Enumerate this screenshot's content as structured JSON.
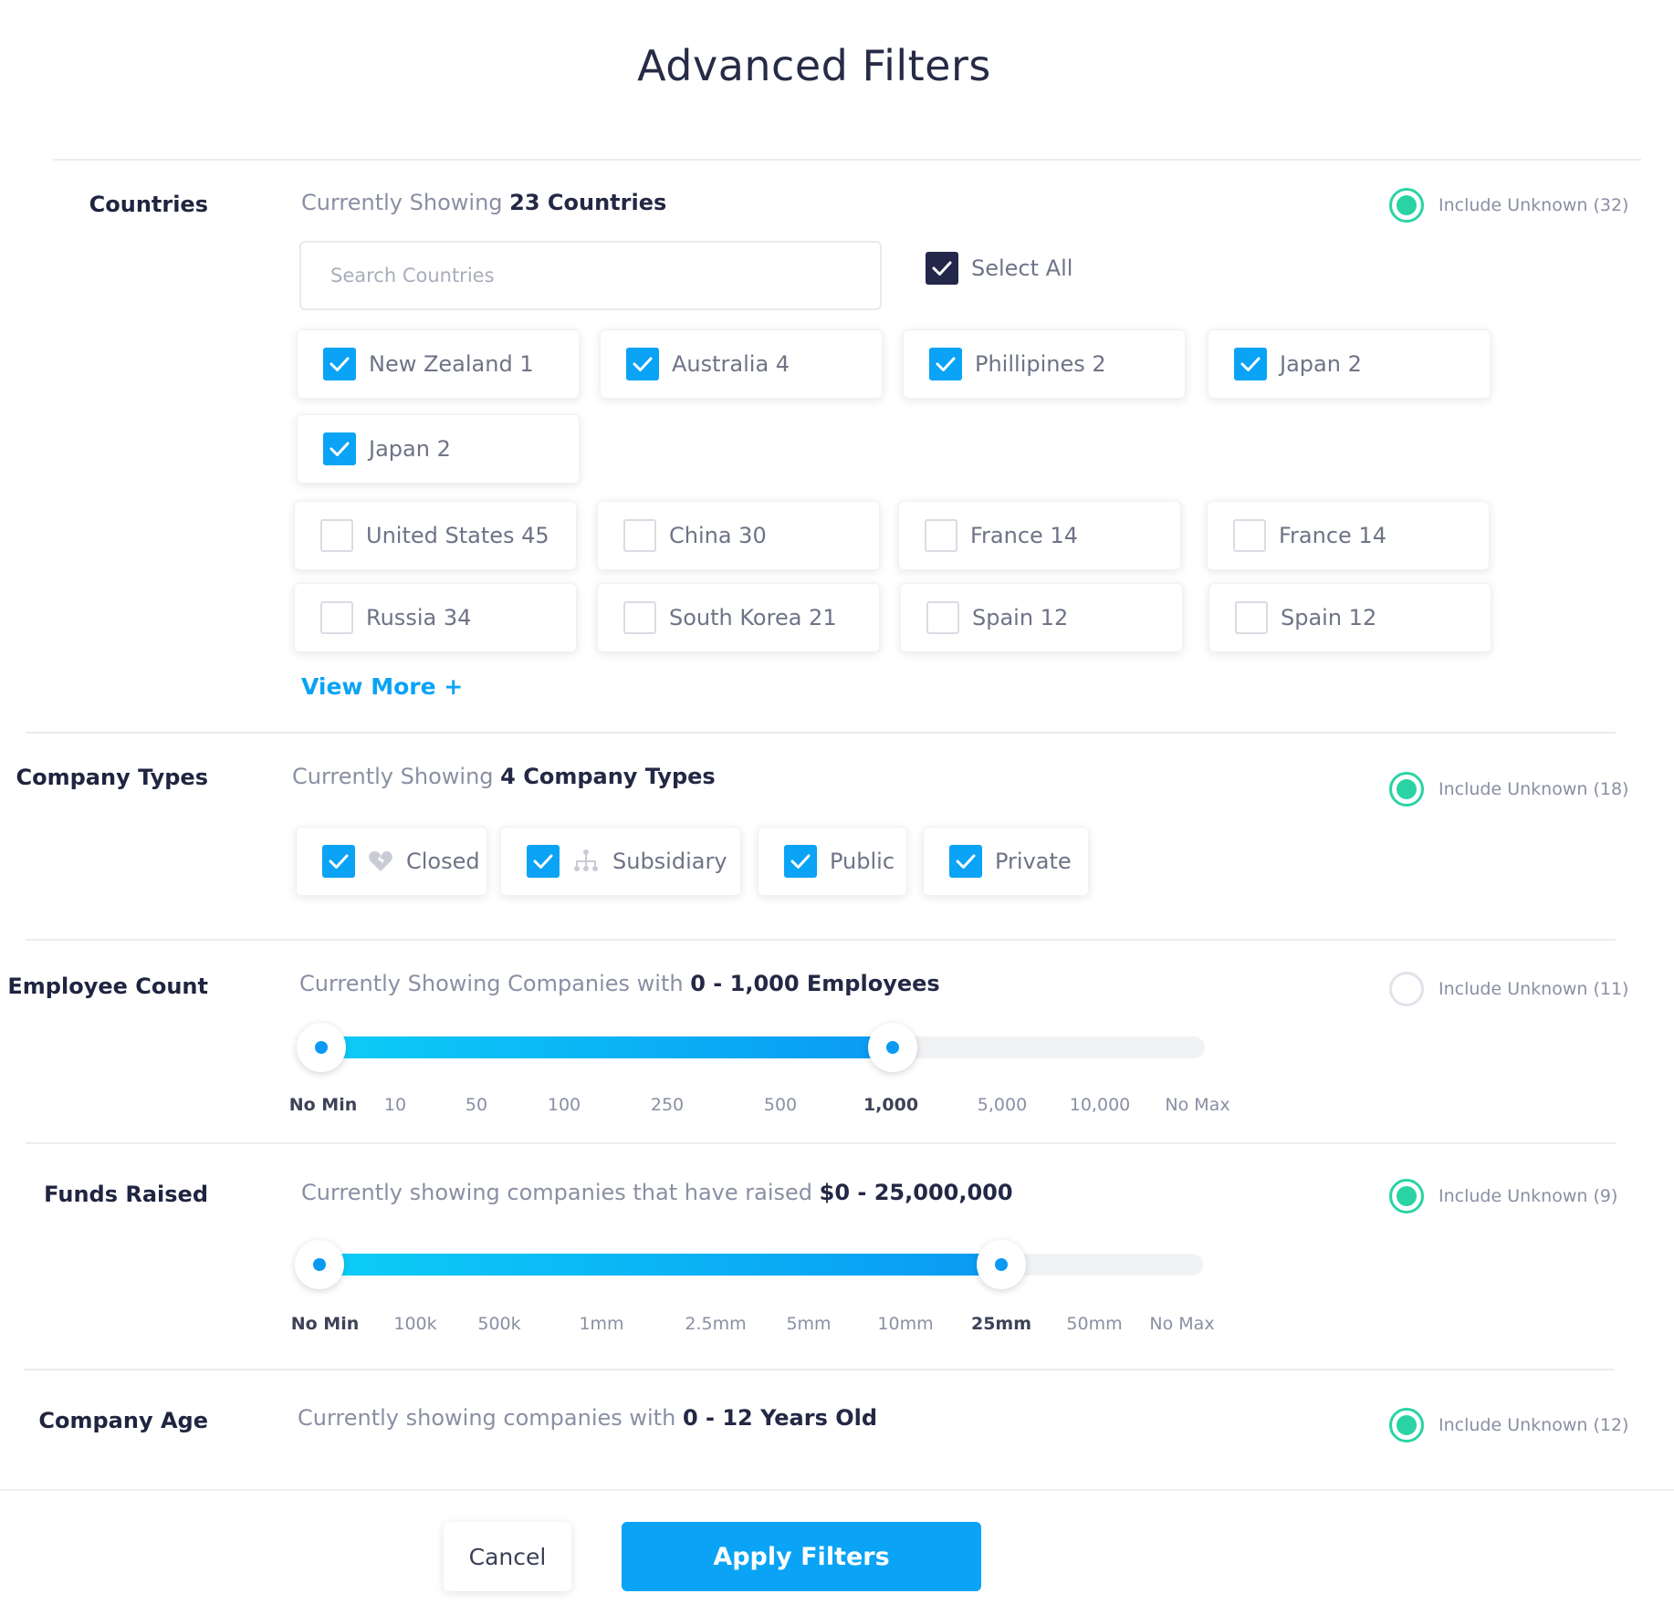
{
  "title": "Advanced Filters",
  "countries": {
    "label": "Countries",
    "showing_prefix": "Currently Showing",
    "showing_value": "23 Countries",
    "include_unknown": "Include Unknown (32)",
    "include_unknown_checked": true,
    "search_placeholder": "Search Countries",
    "select_all_label": "Select All",
    "select_all_checked": true,
    "items": [
      {
        "label": "New Zealand 1",
        "checked": true
      },
      {
        "label": "Australia 4",
        "checked": true
      },
      {
        "label": "Phillipines 2",
        "checked": true
      },
      {
        "label": "Japan 2",
        "checked": true
      },
      {
        "label": "Japan 2",
        "checked": true
      },
      {
        "label": "United States 45",
        "checked": false
      },
      {
        "label": "China 30",
        "checked": false
      },
      {
        "label": "France 14",
        "checked": false
      },
      {
        "label": "France 14",
        "checked": false
      },
      {
        "label": "Russia 34",
        "checked": false
      },
      {
        "label": "South Korea 21",
        "checked": false
      },
      {
        "label": "Spain 12",
        "checked": false
      },
      {
        "label": "Spain 12",
        "checked": false
      }
    ],
    "view_more": "View More +"
  },
  "company_types": {
    "label": "Company Types",
    "showing_prefix": "Currently Showing",
    "showing_value": "4 Company Types",
    "include_unknown": "Include Unknown (18)",
    "include_unknown_checked": true,
    "items": [
      {
        "label": "Closed",
        "icon": "heart-broken-icon",
        "checked": true
      },
      {
        "label": "Subsidiary",
        "icon": "org-chart-icon",
        "checked": true
      },
      {
        "label": "Public",
        "icon": "",
        "checked": true
      },
      {
        "label": "Private",
        "icon": "",
        "checked": true
      }
    ]
  },
  "employee_count": {
    "label": "Employee Count",
    "showing_prefix": "Currently Showing Companies with",
    "showing_value": "0 - 1,000 Employees",
    "include_unknown": "Include Unknown (11)",
    "include_unknown_checked": false,
    "ticks": [
      "No Min",
      "10",
      "50",
      "100",
      "250",
      "500",
      "1,000",
      "5,000",
      "10,000",
      "No Max"
    ],
    "selected_min_index": 0,
    "selected_max_index": 6
  },
  "funds_raised": {
    "label": "Funds Raised",
    "showing_prefix": "Currently showing companies that have raised",
    "showing_value": "$0 - 25,000,000",
    "include_unknown": "Include Unknown (9)",
    "include_unknown_checked": true,
    "ticks": [
      "No Min",
      "100k",
      "500k",
      "1mm",
      "2.5mm",
      "5mm",
      "10mm",
      "25mm",
      "50mm",
      "No Max"
    ],
    "selected_min_index": 0,
    "selected_max_index": 7
  },
  "company_age": {
    "label": "Company Age",
    "showing_prefix": "Currently showing companies with",
    "showing_value": "0 - 12 Years Old",
    "include_unknown": "Include Unknown (12)",
    "include_unknown_checked": true
  },
  "footer": {
    "cancel": "Cancel",
    "apply": "Apply Filters"
  },
  "colors": {
    "accent": "#0aa3f5",
    "radio": "#2ad3a4",
    "text_dark": "#23284a"
  }
}
